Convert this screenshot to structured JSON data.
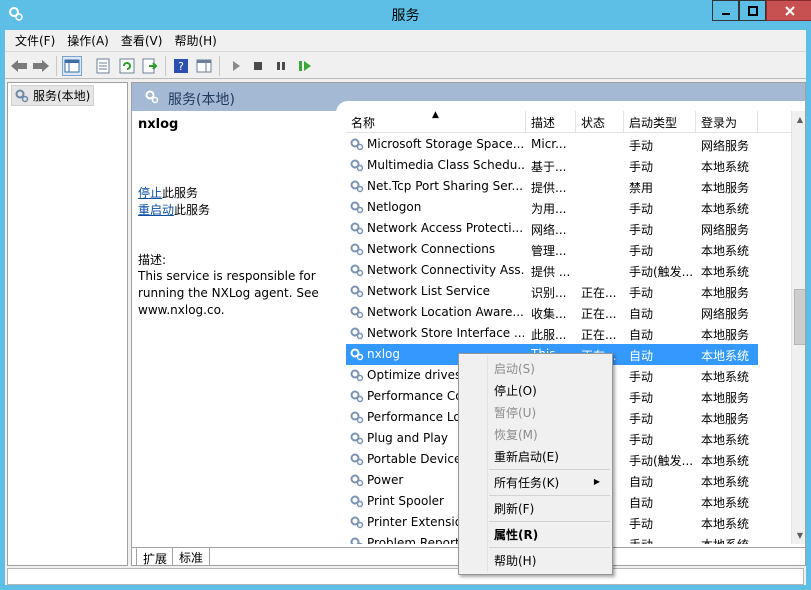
{
  "window": {
    "title": "服务"
  },
  "menubar": [
    {
      "label": "文件(F)"
    },
    {
      "label": "操作(A)"
    },
    {
      "label": "查看(V)"
    },
    {
      "label": "帮助(H)"
    }
  ],
  "tree": {
    "root_label": "服务(本地)"
  },
  "pane_header": {
    "title": "服务(本地)"
  },
  "details": {
    "service_name": "nxlog",
    "stop_link": "停止",
    "stop_suffix": "此服务",
    "restart_link": "重启动",
    "restart_suffix": "此服务",
    "desc_label": "描述:",
    "description": "This service is responsible for running the NXLog agent. See www.nxlog.co."
  },
  "columns": [
    "名称",
    "描述",
    "状态",
    "启动类型",
    "登录为"
  ],
  "rows": [
    {
      "name": "Microsoft Storage Space...",
      "desc": "Micr...",
      "status": "",
      "startup": "手动",
      "logon": "网络服务"
    },
    {
      "name": "Multimedia Class Schedu...",
      "desc": "基于...",
      "status": "",
      "startup": "手动",
      "logon": "本地系统"
    },
    {
      "name": "Net.Tcp Port Sharing Ser...",
      "desc": "提供...",
      "status": "",
      "startup": "禁用",
      "logon": "本地服务"
    },
    {
      "name": "Netlogon",
      "desc": "为用...",
      "status": "",
      "startup": "手动",
      "logon": "本地系统"
    },
    {
      "name": "Network Access Protecti...",
      "desc": "网络...",
      "status": "",
      "startup": "手动",
      "logon": "网络服务"
    },
    {
      "name": "Network Connections",
      "desc": "管理...",
      "status": "",
      "startup": "手动",
      "logon": "本地系统"
    },
    {
      "name": "Network Connectivity Ass...",
      "desc": "提供 ...",
      "status": "",
      "startup": "手动(触发...",
      "logon": "本地系统"
    },
    {
      "name": "Network List Service",
      "desc": "识别...",
      "status": "正在...",
      "startup": "手动",
      "logon": "本地服务"
    },
    {
      "name": "Network Location Aware...",
      "desc": "收集...",
      "status": "正在...",
      "startup": "自动",
      "logon": "网络服务"
    },
    {
      "name": "Network Store Interface ...",
      "desc": "此服...",
      "status": "正在...",
      "startup": "自动",
      "logon": "本地服务"
    },
    {
      "name": "nxlog",
      "desc": "This ...",
      "status": "正在...",
      "startup": "自动",
      "logon": "本地系统",
      "selected": true
    },
    {
      "name": "Optimize drives",
      "desc": "",
      "status": "",
      "startup": "手动",
      "logon": "本地系统"
    },
    {
      "name": "Performance Co",
      "desc": "",
      "status": "",
      "startup": "手动",
      "logon": "本地服务"
    },
    {
      "name": "Performance Lo",
      "desc": "",
      "status": "",
      "startup": "手动",
      "logon": "本地服务"
    },
    {
      "name": "Plug and Play",
      "desc": "",
      "status": "",
      "startup": "手动",
      "logon": "本地系统"
    },
    {
      "name": "Portable Device",
      "desc": "",
      "status": "",
      "startup": "手动(触发...",
      "logon": "本地系统"
    },
    {
      "name": "Power",
      "desc": "",
      "status": "",
      "startup": "自动",
      "logon": "本地系统"
    },
    {
      "name": "Print Spooler",
      "desc": "",
      "status": "",
      "startup": "自动",
      "logon": "本地系统"
    },
    {
      "name": "Printer Extension",
      "desc": "",
      "status": "",
      "startup": "手动",
      "logon": "本地系统"
    },
    {
      "name": "Problem Report",
      "desc": "",
      "status": "",
      "startup": "手动",
      "logon": "本地系统"
    }
  ],
  "tabs": [
    {
      "label": "扩展"
    },
    {
      "label": "标准"
    }
  ],
  "context_menu": {
    "start": "启动(S)",
    "stop": "停止(O)",
    "pause": "暂停(U)",
    "resume": "恢复(M)",
    "restart": "重新启动(E)",
    "all_tasks": "所有任务(K)",
    "refresh": "刷新(F)",
    "properties": "属性(R)",
    "help": "帮助(H)"
  },
  "colors": {
    "titlebar": "#5ebfe6",
    "selection": "#3399ff",
    "pane_header": "#a4b9d4",
    "close_button": "#c75050"
  }
}
